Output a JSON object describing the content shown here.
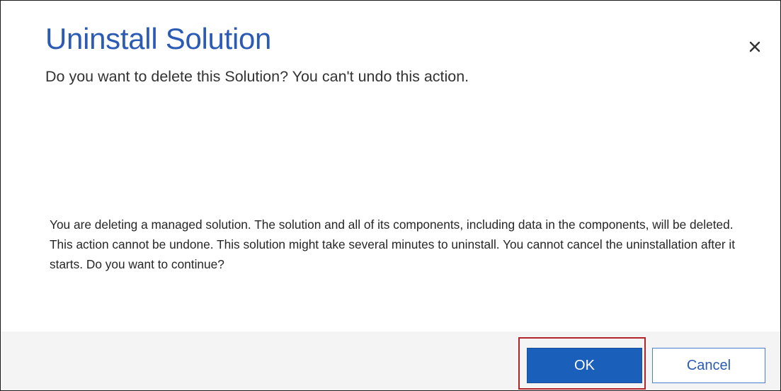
{
  "dialog": {
    "title": "Uninstall Solution",
    "subtitle": "Do you want to delete this Solution? You can't undo this action.",
    "message": "You are deleting a managed solution. The solution and all of its components, including data in the components, will be deleted. This action cannot be undone. This solution might take several minutes to uninstall. You cannot cancel the uninstallation after it starts. Do you want to continue?",
    "close_icon": "close-icon",
    "buttons": {
      "ok_label": "OK",
      "cancel_label": "Cancel"
    }
  },
  "colors": {
    "title": "#2b5bb5",
    "ok_background": "#1a5fba",
    "highlight_border": "#b0242a",
    "footer_background": "#f4f4f4"
  }
}
